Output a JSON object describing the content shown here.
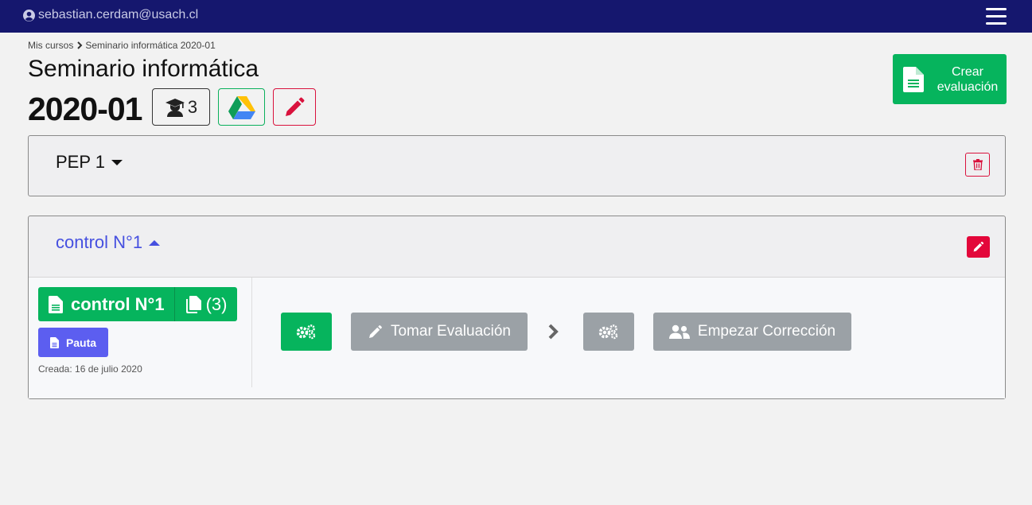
{
  "topbar": {
    "user_email": "sebastian.cerdam@usach.cl",
    "menu_icon": "hamburger-menu-icon",
    "user_icon": "user-circle-icon"
  },
  "breadcrumb": {
    "root": "Mis cursos",
    "current": "Seminario informática 2020-01"
  },
  "course": {
    "name": "Seminario informática",
    "period": "2020-01",
    "students_count": "3"
  },
  "header_buttons": {
    "create_label_1": "Crear",
    "create_label_2": "evaluación"
  },
  "sections": [
    {
      "title": "PEP 1",
      "expanded": false
    },
    {
      "title": "control N°1",
      "expanded": true,
      "evaluation": {
        "name": "control N°1",
        "copies": "(3)",
        "pauta_label": "Pauta",
        "created": "Creada: 16 de julio 2020"
      },
      "steps": {
        "take_label": "Tomar Evaluación",
        "correct_label": "Empezar Corrección"
      }
    }
  ],
  "colors": {
    "navbar": "#15176e",
    "success": "#06b45d",
    "danger": "#e3073a",
    "primary": "#5c5ef0",
    "link": "#4650e0",
    "disabled": "#9ba1a6"
  }
}
